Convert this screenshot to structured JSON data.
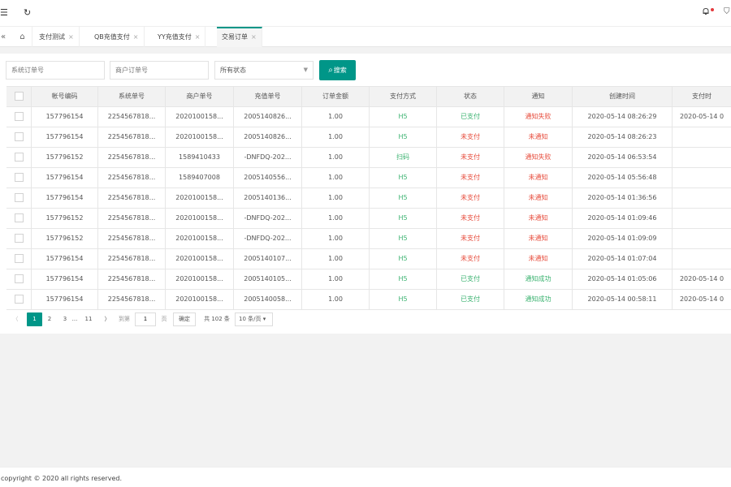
{
  "topbar": {
    "menu_icon": "menu-fold-icon",
    "refresh_icon": "refresh-icon",
    "bell_icon": "bell-icon",
    "shield_icon": "shield-icon"
  },
  "tabs": [
    {
      "label": "支付测试",
      "closable": true
    },
    {
      "label": "QB充值支付",
      "closable": true
    },
    {
      "label": "YY充值支付",
      "closable": true
    },
    {
      "label": "交易订单",
      "closable": true,
      "active": true
    }
  ],
  "tab_close_glyph": "×",
  "search": {
    "system_order_placeholder": "系统订单号",
    "merchant_order_placeholder": "商户订单号",
    "status_select_value": "所有状态",
    "button_label": "搜索"
  },
  "table": {
    "headers": [
      "",
      "帐号编码",
      "系统单号",
      "商户单号",
      "充值单号",
      "订单金额",
      "支付方式",
      "状态",
      "通知",
      "创建时间",
      "支付时"
    ],
    "rows": [
      [
        "157796154",
        "2254567818...",
        "2020100158...",
        "2005140826...",
        "1.00",
        "H5",
        "已支付",
        "通知失败",
        "2020-05-14 08:26:29",
        "2020-05-14 0"
      ],
      [
        "157796154",
        "2254567818...",
        "2020100158...",
        "2005140826...",
        "1.00",
        "H5",
        "未支付",
        "未通知",
        "2020-05-14 08:26:23",
        ""
      ],
      [
        "157796152",
        "2254567818...",
        "1589410433",
        "-DNFDQ-202...",
        "1.00",
        "扫码",
        "未支付",
        "通知失败",
        "2020-05-14 06:53:54",
        ""
      ],
      [
        "157796154",
        "2254567818...",
        "1589407008",
        "2005140556...",
        "1.00",
        "H5",
        "未支付",
        "未通知",
        "2020-05-14 05:56:48",
        ""
      ],
      [
        "157796154",
        "2254567818...",
        "2020100158...",
        "2005140136...",
        "1.00",
        "H5",
        "未支付",
        "未通知",
        "2020-05-14 01:36:56",
        ""
      ],
      [
        "157796152",
        "2254567818...",
        "2020100158...",
        "-DNFDQ-202...",
        "1.00",
        "H5",
        "未支付",
        "未通知",
        "2020-05-14 01:09:46",
        ""
      ],
      [
        "157796152",
        "2254567818...",
        "2020100158...",
        "-DNFDQ-202...",
        "1.00",
        "H5",
        "未支付",
        "未通知",
        "2020-05-14 01:09:09",
        ""
      ],
      [
        "157796154",
        "2254567818...",
        "2020100158...",
        "2005140107...",
        "1.00",
        "H5",
        "未支付",
        "未通知",
        "2020-05-14 01:07:04",
        ""
      ],
      [
        "157796154",
        "2254567818...",
        "2020100158...",
        "2005140105...",
        "1.00",
        "H5",
        "已支付",
        "通知成功",
        "2020-05-14 01:05:06",
        "2020-05-14 0"
      ],
      [
        "157796154",
        "2254567818...",
        "2020100158...",
        "2005140058...",
        "1.00",
        "H5",
        "已支付",
        "通知成功",
        "2020-05-14 00:58:11",
        "2020-05-14 0"
      ]
    ]
  },
  "colors": {
    "accent": "#009688",
    "success": "#3cb371",
    "danger": "#e74c3c"
  },
  "pager": {
    "prev": "〈",
    "next": "〉",
    "pages": [
      "1",
      "2",
      "3",
      "...",
      "11"
    ],
    "goto_label": "到第",
    "goto_value": "1",
    "page_unit": "页",
    "confirm_label": "确定",
    "total_label": "共 102 条",
    "page_size": "10 条/页"
  },
  "footer": {
    "copyright": "copyright © 2020 all rights reserved."
  }
}
